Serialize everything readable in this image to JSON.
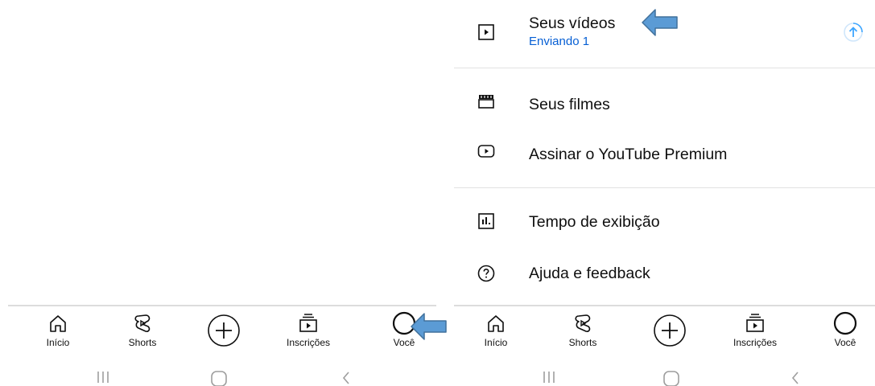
{
  "left_panel": {
    "nav": [
      {
        "label": "Início",
        "icon": "home-icon"
      },
      {
        "label": "Shorts",
        "icon": "shorts-icon"
      },
      {
        "label": "",
        "icon": "create-plus-icon"
      },
      {
        "label": "Inscrições",
        "icon": "subscriptions-icon"
      },
      {
        "label": "Você",
        "icon": "you-avatar-icon"
      }
    ]
  },
  "right_panel": {
    "menu": {
      "your_videos": {
        "label": "Seus vídeos",
        "sublabel": "Enviando 1",
        "icon": "play-square-icon",
        "trailing_icon": "upload-progress-icon"
      },
      "your_movies": {
        "label": "Seus filmes",
        "icon": "clapperboard-icon"
      },
      "premium": {
        "label": "Assinar o YouTube Premium",
        "icon": "youtube-logo-icon"
      },
      "watch_time": {
        "label": "Tempo de exibição",
        "icon": "bar-chart-icon"
      },
      "help": {
        "label": "Ajuda e feedback",
        "icon": "help-circle-icon"
      }
    },
    "nav": [
      {
        "label": "Início",
        "icon": "home-icon"
      },
      {
        "label": "Shorts",
        "icon": "shorts-icon"
      },
      {
        "label": "",
        "icon": "create-plus-icon"
      },
      {
        "label": "Inscrições",
        "icon": "subscriptions-icon"
      },
      {
        "label": "Você",
        "icon": "you-avatar-icon"
      }
    ]
  },
  "system_nav": [
    "recent-apps-icon",
    "home-button-icon",
    "back-icon"
  ],
  "colors": {
    "annotation_arrow": "#5b9bd5",
    "accent_link": "#065fd4",
    "upload_icon": "#3ea6ff"
  }
}
